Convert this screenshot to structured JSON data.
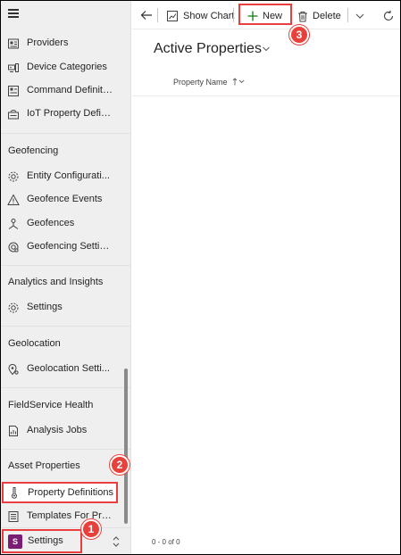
{
  "sidebar": {
    "items_top": [
      {
        "label": "Providers",
        "icon": "providers-icon"
      },
      {
        "label": "Device Categories",
        "icon": "device-categories-icon"
      },
      {
        "label": "Command Definiti...",
        "icon": "command-definitions-icon"
      },
      {
        "label": "IoT Property Defin...",
        "icon": "iot-property-icon"
      }
    ],
    "geofencing": {
      "title": "Geofencing",
      "items": [
        {
          "label": "Entity Configurati...",
          "icon": "gear-icon"
        },
        {
          "label": "Geofence Events",
          "icon": "warning-icon"
        },
        {
          "label": "Geofences",
          "icon": "geofence-icon"
        },
        {
          "label": "Geofencing Settin...",
          "icon": "geofencing-settings-icon"
        }
      ]
    },
    "analytics": {
      "title": "Analytics and Insights",
      "items": [
        {
          "label": "Settings",
          "icon": "gear-icon"
        }
      ]
    },
    "geolocation": {
      "title": "Geolocation",
      "items": [
        {
          "label": "Geolocation Setti...",
          "icon": "geolocation-icon"
        }
      ]
    },
    "health": {
      "title": "FieldService Health",
      "items": [
        {
          "label": "Analysis Jobs",
          "icon": "analysis-jobs-icon"
        }
      ]
    },
    "asset": {
      "title": "Asset Properties",
      "items": [
        {
          "label": "Property Definitions",
          "icon": "thermometer-icon"
        },
        {
          "label": "Templates For Pro...",
          "icon": "templates-icon"
        }
      ]
    },
    "area": {
      "avatar": "S",
      "label": "Settings"
    }
  },
  "commandbar": {
    "show_chart": "Show Chart",
    "new": "New",
    "delete": "Delete"
  },
  "view": {
    "title": "Active Properties",
    "column": "Property Name",
    "record_count": "0 - 0 of 0"
  },
  "callouts": [
    "1",
    "2",
    "3"
  ],
  "colors": {
    "highlight": "#e83e3e",
    "badge": "#e8403a",
    "avatar": "#7a1d73",
    "new_plus": "#107c10"
  }
}
